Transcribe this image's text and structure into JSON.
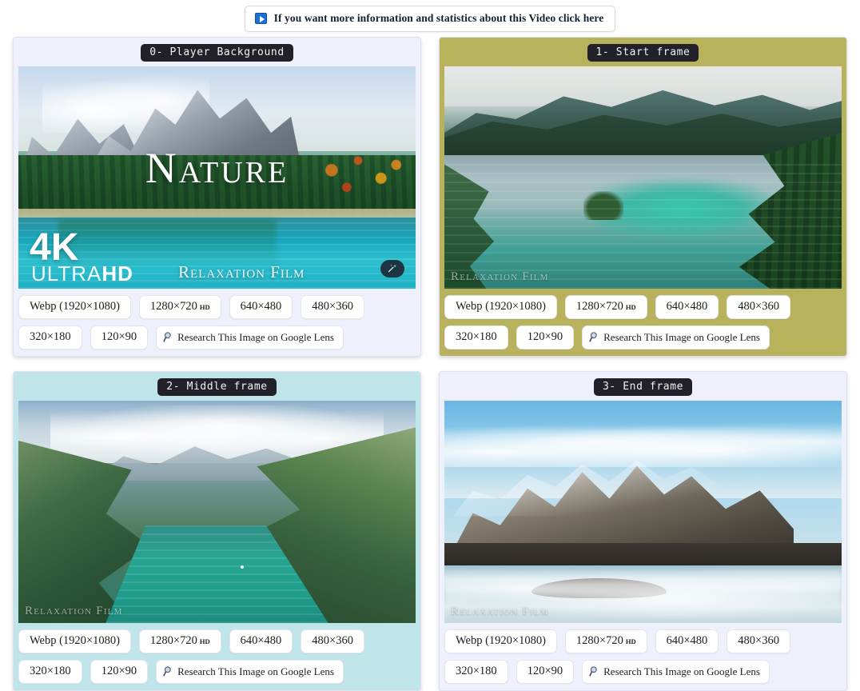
{
  "topbar": {
    "info_button_label": "If you want more information and statistics about this Video click here",
    "play_icon": "play-icon"
  },
  "resolution_buttons": [
    "Webp (1920×1080)",
    "1280×720",
    "640×480",
    "480×360",
    "320×180",
    "120×90"
  ],
  "hd_superscript": "HD",
  "lens_button_label": "Research This Image on Google Lens",
  "lens_icon": "magnifier-icon",
  "colors": {
    "badge_bg": "#222028",
    "badge_text": "#f3f3f5",
    "card_lavender": "#eef0fb",
    "card_olive": "#b9b25d",
    "card_cyan": "#bfe5ea",
    "chip_bg": "#ffffff",
    "accent_blue": "#1b72d4"
  },
  "cards": [
    {
      "badge": "0- Player Background",
      "tone": "tone-lavender",
      "overlay": {
        "title": "Nature",
        "quality_big": "4K",
        "quality_sub_light": "ULTRA",
        "quality_sub_bold": "HD",
        "watermark": "Relaxation Film",
        "magic_badge": "magic-wand-icon"
      }
    },
    {
      "badge": "1- Start frame",
      "tone": "tone-olive",
      "overlay": {
        "watermark": "Relaxation Film"
      }
    },
    {
      "badge": "2- Middle frame",
      "tone": "tone-cyan",
      "overlay": {
        "watermark": "Relaxation Film"
      }
    },
    {
      "badge": "3- End frame",
      "tone": "tone-lavender",
      "overlay": {
        "watermark": "Relaxation Film"
      }
    }
  ]
}
